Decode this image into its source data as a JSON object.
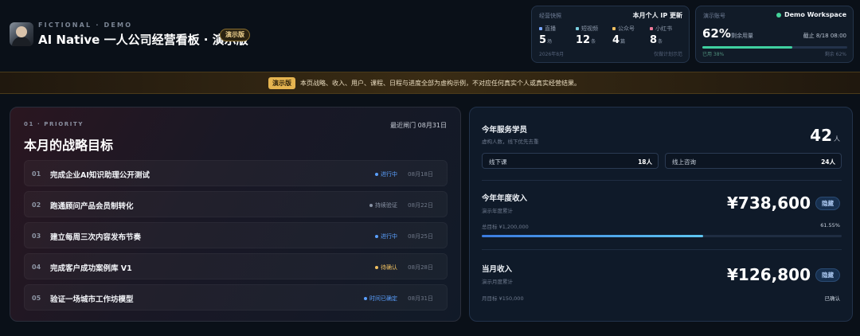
{
  "header": {
    "kicker": "FICTIONAL · DEMO",
    "title": "AI Native 一人公司经营看板 · 演示版",
    "badge": "演示版"
  },
  "ip_card": {
    "label": "经营快照",
    "title": "本月个人 IP 更新",
    "items": [
      {
        "name": "直播",
        "value": "5",
        "unit": "场",
        "color": "#7aa7ff"
      },
      {
        "name": "短视频",
        "value": "12",
        "unit": "条",
        "color": "#7ad0e0"
      },
      {
        "name": "公众号",
        "value": "4",
        "unit": "篇",
        "color": "#f0c060"
      },
      {
        "name": "小红书",
        "value": "8",
        "unit": "条",
        "color": "#f07a9a"
      }
    ],
    "footer_left": "2026年8月",
    "footer_right": "仅做计划示范"
  },
  "workspace_card": {
    "label": "演示账号",
    "title": "Demo Workspace",
    "status_color": "#44d39a",
    "percent": "62%",
    "percent_label": "剩余用量",
    "date": "截止 8/18 08:00",
    "progress_fraction": 0.62,
    "footer_left": "已用 38%",
    "footer_right": "剩余 62%"
  },
  "banner": {
    "tag": "演示版",
    "message": "本页战略、收入、用户、课程、日程与进度全部为虚构示例，不对应任何真实个人或真实经营结果。"
  },
  "goals_panel": {
    "kicker": "01 · PRIORITY",
    "title": "本月的战略目标",
    "deadline": "最近闸门 08月31日",
    "goals": [
      {
        "num": "01",
        "name": "完成企业AI知识助理公开测试",
        "status": "进行中",
        "status_color": "#5aa0ff",
        "date": "08月18日"
      },
      {
        "num": "02",
        "name": "跑通顾问产品会员制转化",
        "status": "持续验证",
        "status_color": "#8a94a6",
        "date": "08月22日"
      },
      {
        "num": "03",
        "name": "建立每周三次内容发布节奏",
        "status": "进行中",
        "status_color": "#5aa0ff",
        "date": "08月25日"
      },
      {
        "num": "04",
        "name": "完成客户成功案例库 V1",
        "status": "待确认",
        "status_color": "#f0c060",
        "date": "08月28日"
      },
      {
        "num": "05",
        "name": "验证一场城市工作坊模型",
        "status": "时间已确定",
        "status_color": "#5aa0ff",
        "date": "08月31日"
      }
    ]
  },
  "stats_panel": {
    "students": {
      "title": "今年服务学员",
      "subtitle": "虚构人数，线下优先去重",
      "value": "42",
      "unit": "人",
      "offline_label": "线下课",
      "offline_value": "18人",
      "online_label": "线上咨询",
      "online_value": "24人"
    },
    "annual": {
      "title": "今年年度收入",
      "subtitle": "演示年度累计",
      "value": "¥738,600",
      "hide_label": "隐藏",
      "target": "总目标 ¥1,200,000",
      "percent": "61.55%",
      "progress_fraction": 0.6155
    },
    "monthly": {
      "title": "当月收入",
      "subtitle": "演示月度累计",
      "value": "¥126,800",
      "hide_label": "隐藏",
      "target": "月目标 ¥150,000",
      "status": "已确认"
    }
  }
}
